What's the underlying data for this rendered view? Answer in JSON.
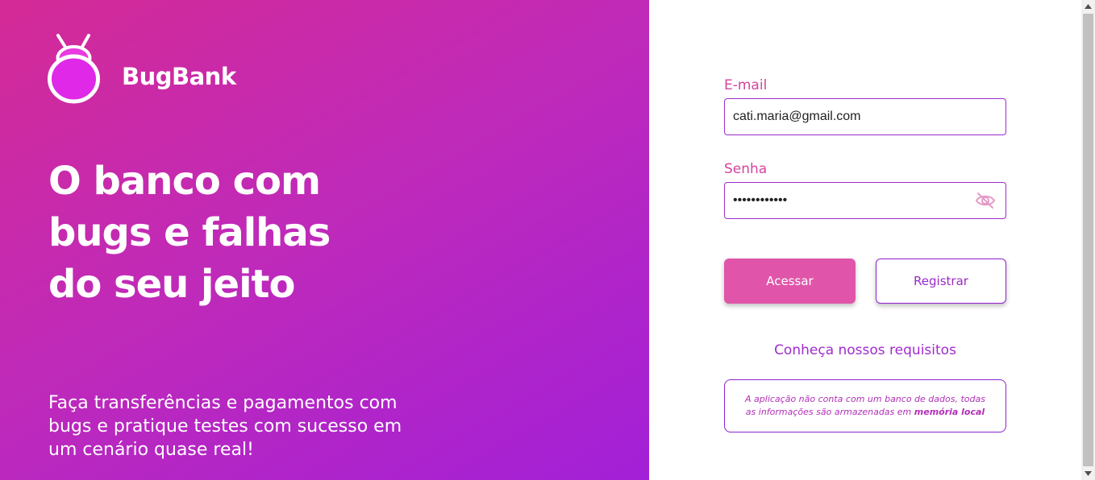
{
  "brand": {
    "name": "BugBank",
    "logo_icon": "bug-logo-icon"
  },
  "hero": {
    "headline": [
      "O banco com",
      "bugs e falhas",
      "do seu jeito"
    ],
    "subtext": [
      "Faça transferências e pagamentos com",
      "bugs e pratique testes com sucesso em",
      "um cenário quase real!"
    ]
  },
  "login": {
    "email_label": "E-mail",
    "email_value": "cati.maria@gmail.com",
    "password_label": "Senha",
    "password_value": "••••••••••••",
    "password_toggle_icon": "eye-slash-icon",
    "access_button": "Acessar",
    "register_button": "Registrar",
    "requirements_link": "Conheça nossos requisitos",
    "notice_text_1": "A aplicação não conta com um banco de dados, todas",
    "notice_text_2": "as informações são armazenadas em",
    "notice_bold": "memória local"
  },
  "colors": {
    "gradient_start": "#d42a96",
    "gradient_end": "#a220d8",
    "accent_pink": "#e055a9",
    "accent_purple": "#a02ccf"
  }
}
